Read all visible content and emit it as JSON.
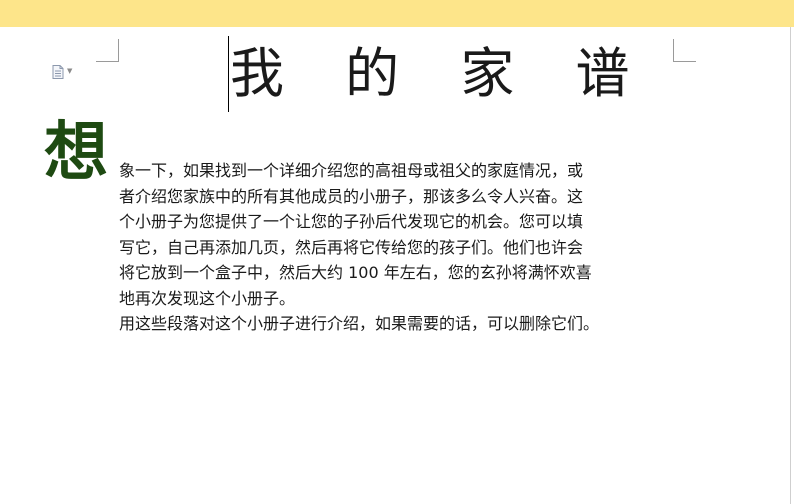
{
  "document": {
    "title": "我 的 家 谱",
    "drop_cap": "想",
    "paragraph_lines": [
      "象一下，如果找到一个详细介绍您的高祖母或祖父的家庭情况，或",
      "者介绍您家族中的所有其他成员的小册子，那该多么令人兴奋。这",
      "个小册子为您提供了一个让您的子孙后代发现它的机会。您可以填",
      "写它，自己再添加几页，然后再将它传给您的孩子们。他们也许会",
      "将它放到一个盒子中，然后大约 100 年左右，您的玄孙将满怀欢喜",
      "地再次发现这个小册子。"
    ],
    "closing_note": "用这些段落对这个小册子进行介绍，如果需要的话，可以删除它们。"
  },
  "colors": {
    "top_band": "#fde58a",
    "drop_cap": "#1e4a12",
    "text": "#1a1a1a"
  },
  "icons": {
    "paste_options": "document-icon",
    "paste_options_arrow": "chevron-down-icon"
  }
}
